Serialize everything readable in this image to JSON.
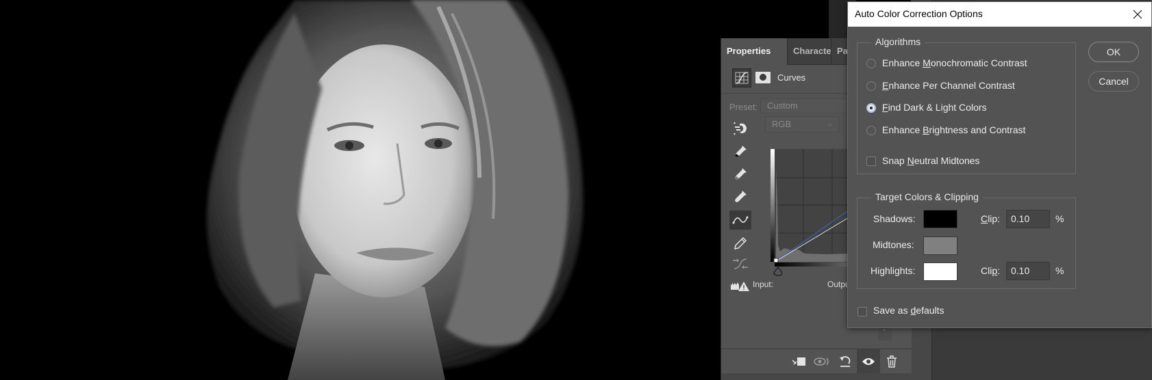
{
  "canvas": {
    "description": "Black and white portrait of a young woman with shoulder-length hair on black background"
  },
  "properties_panel": {
    "tabs": [
      {
        "label": "Properties",
        "active": true
      },
      {
        "label": "Characte",
        "active": false
      },
      {
        "label": "Parag",
        "active": false
      }
    ],
    "adjustment_icon": "curves-adjustment-icon",
    "mask_icon": "layer-mask-icon",
    "adjustment_name": "Curves",
    "preset_label": "Preset:",
    "preset_value": "Custom",
    "channel_value": "RGB",
    "tools": [
      {
        "name": "on-image-adjust-icon",
        "selected": false
      },
      {
        "name": "black-point-eyedropper-icon",
        "selected": false
      },
      {
        "name": "gray-point-eyedropper-icon",
        "selected": false
      },
      {
        "name": "white-point-eyedropper-icon",
        "selected": false
      },
      {
        "name": "edit-points-curve-icon",
        "selected": true
      },
      {
        "name": "pencil-draw-icon",
        "selected": false
      },
      {
        "name": "smooth-curve-icon",
        "selected": false
      },
      {
        "name": "clipping-warning-icon",
        "selected": false
      }
    ],
    "input_label": "Input:",
    "output_label": "Outpu",
    "bottom_buttons": [
      {
        "name": "clip-to-layer-icon"
      },
      {
        "name": "view-previous-state-icon"
      },
      {
        "name": "reset-icon"
      },
      {
        "name": "toggle-visibility-icon"
      },
      {
        "name": "delete-icon"
      }
    ]
  },
  "dialog": {
    "title": "Auto Color Correction Options",
    "close_icon": "close-icon",
    "algorithms": {
      "title": "Algorithms",
      "options": [
        {
          "pre": "Enhance ",
          "u": "M",
          "post": "onochromatic Contrast",
          "selected": false
        },
        {
          "pre": "",
          "u": "E",
          "post": "nhance Per Channel Contrast",
          "selected": false
        },
        {
          "pre": "",
          "u": "F",
          "post": "ind Dark & Light Colors",
          "selected": true
        },
        {
          "pre": "Enhance ",
          "u": "B",
          "post": "rightness and Contrast",
          "selected": false
        }
      ],
      "snap": {
        "pre": "Snap ",
        "u": "N",
        "post": "eutral Midtones",
        "checked": false
      }
    },
    "target": {
      "title": "Target Colors & Clipping",
      "shadows": {
        "label": "Shadows:",
        "color": "#000000",
        "clip_label_pre": "",
        "clip_u": "C",
        "clip_label_post": "lip:",
        "clip": "0.10",
        "unit": "%"
      },
      "midtones": {
        "label": "Midtones:",
        "color": "#808080"
      },
      "highlights": {
        "label": "Highlights:",
        "color": "#ffffff",
        "clip_label_pre": "Cli",
        "clip_u": "p",
        "clip_label_post": ":",
        "clip": "0.10",
        "unit": "%"
      }
    },
    "save_defaults": {
      "pre": "Save as ",
      "u": "d",
      "post": "efaults",
      "checked": false
    },
    "ok_label": "OK",
    "cancel_label": "Cancel"
  }
}
